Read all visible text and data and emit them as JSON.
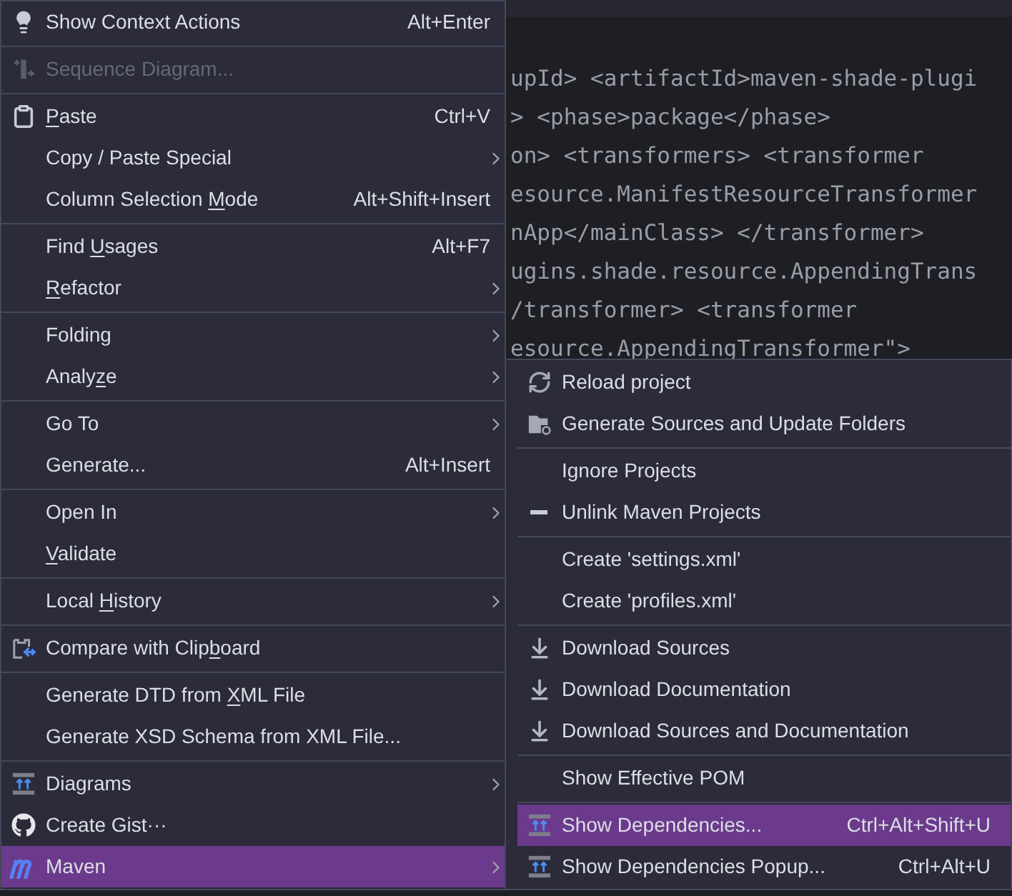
{
  "editor": {
    "lines": [
      "upId> <artifactId>maven-shade-plugi",
      "> <phase>package</phase>",
      "on> <transformers> <transformer",
      "esource.ManifestResourceTransformer",
      "nApp</mainClass> </transformer>",
      "ugins.shade.resource.AppendingTrans",
      "/transformer> <transformer",
      "esource.AppendingTransformer\">"
    ]
  },
  "context_menu": {
    "groups": [
      [
        {
          "label": "Show Context Actions",
          "shortcut": "Alt+Enter",
          "submenu": false,
          "disabled": false,
          "selected": false
        }
      ],
      [
        {
          "label": "Sequence Diagram...",
          "submenu": false,
          "disabled": true,
          "selected": false
        }
      ],
      [
        {
          "mnemonic": {
            "key": "P",
            "after": "aste"
          },
          "shortcut": "Ctrl+V",
          "submenu": false,
          "disabled": false,
          "selected": false
        },
        {
          "label": "Copy / Paste Special",
          "submenu": true,
          "disabled": false,
          "selected": false
        },
        {
          "mnemonic": {
            "before": "Column Selection ",
            "key": "M",
            "after": "ode"
          },
          "shortcut": "Alt+Shift+Insert",
          "submenu": false,
          "disabled": false,
          "selected": false
        }
      ],
      [
        {
          "mnemonic": {
            "before": "Find ",
            "key": "U",
            "after": "sages"
          },
          "shortcut": "Alt+F7",
          "submenu": false,
          "disabled": false,
          "selected": false
        },
        {
          "mnemonic": {
            "key": "R",
            "after": "efactor"
          },
          "submenu": true,
          "disabled": false,
          "selected": false
        }
      ],
      [
        {
          "label": "Folding",
          "submenu": true,
          "disabled": false,
          "selected": false
        },
        {
          "mnemonic": {
            "before": "Analy",
            "key": "z",
            "after": "e"
          },
          "submenu": true,
          "disabled": false,
          "selected": false
        }
      ],
      [
        {
          "label": "Go To",
          "submenu": true,
          "disabled": false,
          "selected": false
        },
        {
          "label": "Generate...",
          "shortcut": "Alt+Insert",
          "submenu": false,
          "disabled": false,
          "selected": false
        }
      ],
      [
        {
          "label": "Open In",
          "submenu": true,
          "disabled": false,
          "selected": false
        },
        {
          "mnemonic": {
            "key": "V",
            "after": "alidate"
          },
          "submenu": false,
          "disabled": false,
          "selected": false
        }
      ],
      [
        {
          "mnemonic": {
            "before": "Local ",
            "key": "H",
            "after": "istory"
          },
          "submenu": true,
          "disabled": false,
          "selected": false
        }
      ],
      [
        {
          "mnemonic": {
            "before": "Compare with Clip",
            "key": "b",
            "after": "oard"
          },
          "submenu": false,
          "disabled": false,
          "selected": false
        }
      ],
      [
        {
          "mnemonic": {
            "before": "Generate DTD from ",
            "key": "X",
            "after": "ML File"
          },
          "submenu": false,
          "disabled": false,
          "selected": false
        },
        {
          "label": "Generate XSD Schema from XML File...",
          "submenu": false,
          "disabled": false,
          "selected": false
        }
      ],
      [
        {
          "label": "Diagrams",
          "submenu": true,
          "disabled": false,
          "selected": false
        },
        {
          "label": "Create Gist···",
          "submenu": false,
          "disabled": false,
          "selected": false
        },
        {
          "label": "Maven",
          "submenu": true,
          "disabled": false,
          "selected": true
        }
      ]
    ]
  },
  "maven_submenu": {
    "groups": [
      [
        {
          "label": "Reload project",
          "selected": false
        },
        {
          "label": "Generate Sources and Update Folders",
          "selected": false
        }
      ],
      [
        {
          "label": "Ignore Projects",
          "selected": false
        },
        {
          "label": "Unlink Maven Projects",
          "selected": false
        }
      ],
      [
        {
          "label": "Create 'settings.xml'",
          "selected": false
        },
        {
          "label": "Create 'profiles.xml'",
          "selected": false
        }
      ],
      [
        {
          "label": "Download Sources",
          "selected": false
        },
        {
          "label": "Download Documentation",
          "selected": false
        },
        {
          "label": "Download Sources and Documentation",
          "selected": false
        }
      ],
      [
        {
          "label": "Show Effective POM",
          "selected": false
        }
      ],
      [
        {
          "label": "Show Dependencies...",
          "shortcut": "Ctrl+Alt+Shift+U",
          "selected": true
        },
        {
          "label": "Show Dependencies Popup...",
          "shortcut": "Ctrl+Alt+U",
          "selected": false
        }
      ]
    ]
  }
}
